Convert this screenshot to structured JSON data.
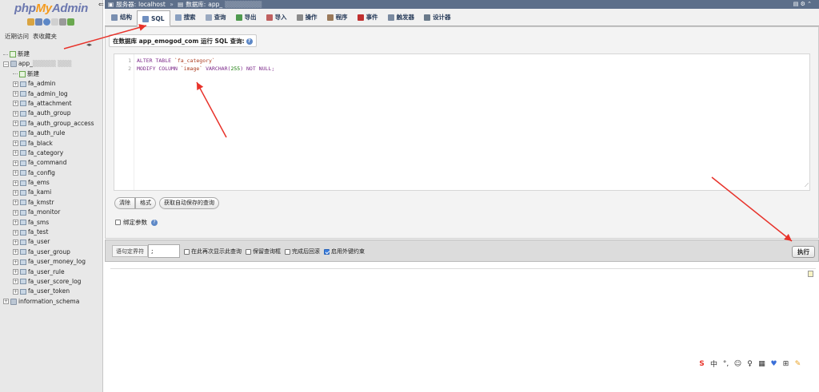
{
  "logo": {
    "php": "php",
    "my": "My",
    "admin": "Admin"
  },
  "nav": {
    "recent": "近期访问",
    "favorites": "表收藏夹",
    "collapse": "◂▸",
    "new_root": "新建",
    "db_name": "app_",
    "db_new": "新建",
    "tables": [
      "fa_admin",
      "fa_admin_log",
      "fa_attachment",
      "fa_auth_group",
      "fa_auth_group_access",
      "fa_auth_rule",
      "fa_black",
      "fa_category",
      "fa_command",
      "fa_config",
      "fa_ems",
      "fa_kami",
      "fa_kmstr",
      "fa_monitor",
      "fa_sms",
      "fa_test",
      "fa_user",
      "fa_user_group",
      "fa_user_money_log",
      "fa_user_rule",
      "fa_user_score_log",
      "fa_user_token"
    ],
    "other_db": "information_schema"
  },
  "topbar": {
    "server_label": "服务器:",
    "server": "localhost",
    "sep": "»",
    "db_label": "数据库:",
    "db": "app_",
    "right_icons": "▤ ⚙ ⌃"
  },
  "tabs": [
    {
      "label": "结构",
      "color": "#7a8fb0"
    },
    {
      "label": "SQL",
      "color": "#6f8fc0"
    },
    {
      "label": "搜索",
      "color": "#8aa0c0"
    },
    {
      "label": "查询",
      "color": "#9aa9c0"
    },
    {
      "label": "导出",
      "color": "#4f9a4f"
    },
    {
      "label": "导入",
      "color": "#c06060"
    },
    {
      "label": "操作",
      "color": "#8a8a8a"
    },
    {
      "label": "程序",
      "color": "#9a7a5a"
    },
    {
      "label": "事件",
      "color": "#c03030"
    },
    {
      "label": "触发器",
      "color": "#7a8aa0"
    },
    {
      "label": "设计器",
      "color": "#6a7a8a"
    }
  ],
  "legend": {
    "text": "在数据库 app_emogod_com 运行 SQL 查询:",
    "help": "?"
  },
  "editor": {
    "lines": [
      {
        "num": "1",
        "kw1": "ALTER TABLE ",
        "str1": "`fa_category`",
        "rest": ""
      },
      {
        "num": "2",
        "kw1": "MODIFY COLUMN ",
        "str1": "`image`",
        "kw2": " VARCHAR(",
        "num1": "255",
        "kw3": ") NOT NULL;"
      }
    ],
    "grip": "⟋"
  },
  "buttons": {
    "clear": "清除",
    "format": "格式",
    "get_autosaved": "获取自动保存的查询"
  },
  "bind_params": {
    "label": "绑定参数",
    "help": "?"
  },
  "options": {
    "delimiter_label": "语句定界符",
    "delimiter_value": ";",
    "show_again": "在此再次显示此查询",
    "retain_box": "保留查询框",
    "rollback": "完成后回滚",
    "foreign_keys": "启用外键约束",
    "go": "执行"
  },
  "ime": [
    "S",
    "中",
    "°,",
    "☺",
    "♀",
    "▦",
    "♥",
    "⊞",
    "✎"
  ]
}
